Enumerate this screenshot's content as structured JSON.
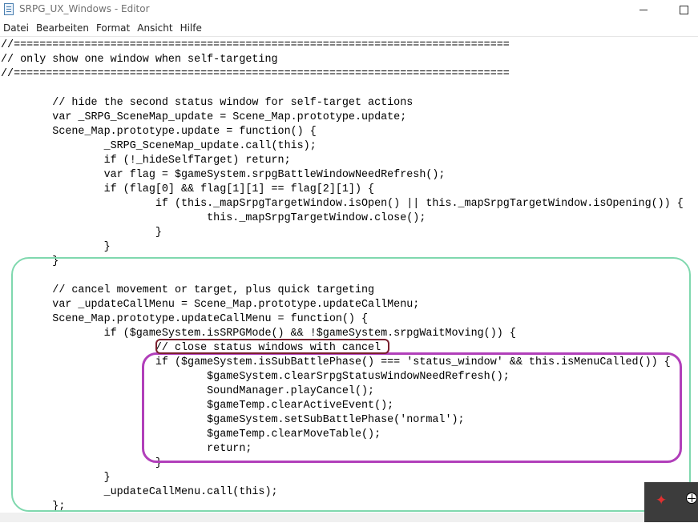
{
  "window": {
    "title": "SRPG_UX_Windows - Editor",
    "icon": "notepad-icon",
    "controls": [
      "minimize-icon",
      "maximize-icon"
    ]
  },
  "menu": {
    "items": [
      "Datei",
      "Bearbeiten",
      "Format",
      "Ansicht",
      "Hilfe"
    ]
  },
  "editor": {
    "lines": [
      "//=============================================================================",
      "// only show one window when self-targeting",
      "//=============================================================================",
      "",
      "\t// hide the second status window for self-target actions",
      "\tvar _SRPG_SceneMap_update = Scene_Map.prototype.update;",
      "\tScene_Map.prototype.update = function() {",
      "\t\t_SRPG_SceneMap_update.call(this);",
      "\t\tif (!_hideSelfTarget) return;",
      "\t\tvar flag = $gameSystem.srpgBattleWindowNeedRefresh();",
      "\t\tif (flag[0] && flag[1][1] == flag[2][1]) {",
      "\t\t\tif (this._mapSrpgTargetWindow.isOpen() || this._mapSrpgTargetWindow.isOpening()) {",
      "\t\t\t\tthis._mapSrpgTargetWindow.close();",
      "\t\t\t}",
      "\t\t}",
      "\t}",
      "",
      "\t// cancel movement or target, plus quick targeting",
      "\tvar _updateCallMenu = Scene_Map.prototype.updateCallMenu;",
      "\tScene_Map.prototype.updateCallMenu = function() {",
      "\t\tif ($gameSystem.isSRPGMode() && !$gameSystem.srpgWaitMoving()) {",
      "\t\t\t// close status windows with cancel",
      "\t\t\tif ($gameSystem.isSubBattlePhase() === 'status_window' && this.isMenuCalled()) {",
      "\t\t\t\t$gameSystem.clearSrpgStatusWindowNeedRefresh();",
      "\t\t\t\tSoundManager.playCancel();",
      "\t\t\t\t$gameTemp.clearActiveEvent();",
      "\t\t\t\t$gameSystem.setSubBattlePhase('normal');",
      "\t\t\t\t$gameTemp.clearMoveTable();",
      "\t\t\t\treturn;",
      "\t\t\t}",
      "\t\t}",
      "\t\t_updateCallMenu.call(this);",
      "\t};"
    ]
  },
  "annotations": {
    "colors": {
      "green": "#7fd8ae",
      "purple": "#b13fba",
      "dark_red": "#7a1f2e"
    }
  },
  "overlay": {
    "icon": "gamepad-icon",
    "icon_color": "#e03030"
  }
}
